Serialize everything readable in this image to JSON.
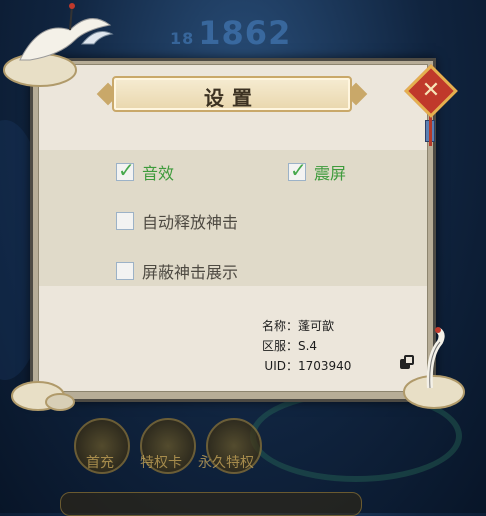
{
  "background": {
    "score": "181862",
    "score_prefix": "18",
    "score_main": "1862",
    "bottom_buttons": [
      "首充",
      "特权卡",
      "永久特权"
    ]
  },
  "dialog": {
    "title": "设置",
    "close_icon": "close-icon",
    "options": [
      {
        "label": "音效",
        "checked": true
      },
      {
        "label": "震屏",
        "checked": true
      },
      {
        "label": "自动释放神击",
        "checked": false
      },
      {
        "label": "屏蔽神击展示",
        "checked": false
      }
    ],
    "info": {
      "name_key": "名称：",
      "name_val": "蓬可歆",
      "server_key": "区服：",
      "server_val": "S.4",
      "uid_key": "UID：",
      "uid_val": "1703940"
    },
    "copy_icon": "copy-icon"
  },
  "colors": {
    "checked_text": "#3e9b3c",
    "close_button": "#c0392b",
    "panel": "#ece6db"
  }
}
